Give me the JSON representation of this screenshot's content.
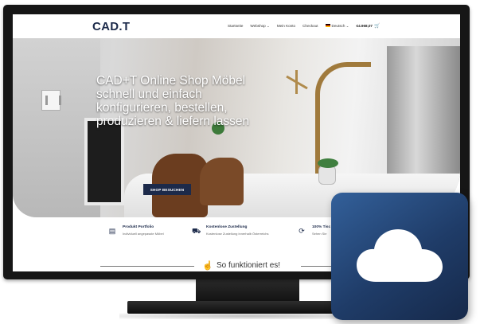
{
  "header": {
    "logo": "CAD.T",
    "nav": [
      "Startseite",
      "Webshop ⌄",
      "Mein Konto",
      "Checkout",
      "Deutsch ⌄"
    ],
    "cart_amount": "€4.968,07",
    "cart_icon": "cart-icon"
  },
  "hero": {
    "title": "CAD+T Online Shop Möbel schnell und einfach konfigurieren, bestellen, produzieren & liefern lassen",
    "button": "SHOP BESUCHEN"
  },
  "features": [
    {
      "icon": "box-icon",
      "title": "Produkt Portfolio",
      "subtitle": "Individuell angepasste Möbel"
    },
    {
      "icon": "truck-icon",
      "title": "Kostenlose Zustellung",
      "subtitle": "Kostenlose Zustellung innerhalb Österreichs"
    },
    {
      "icon": "refresh-icon",
      "title": "100% Tisc",
      "subtitle": "Sehen Sie"
    }
  ],
  "how_it_works": {
    "label": "So funktioniert es!",
    "icon": "hand-pointer-icon"
  },
  "overlay": {
    "icon": "cloud-icon"
  },
  "colors": {
    "brand": "#1c2a4a",
    "tile_top": "#33609a",
    "tile_bottom": "#16294a"
  }
}
